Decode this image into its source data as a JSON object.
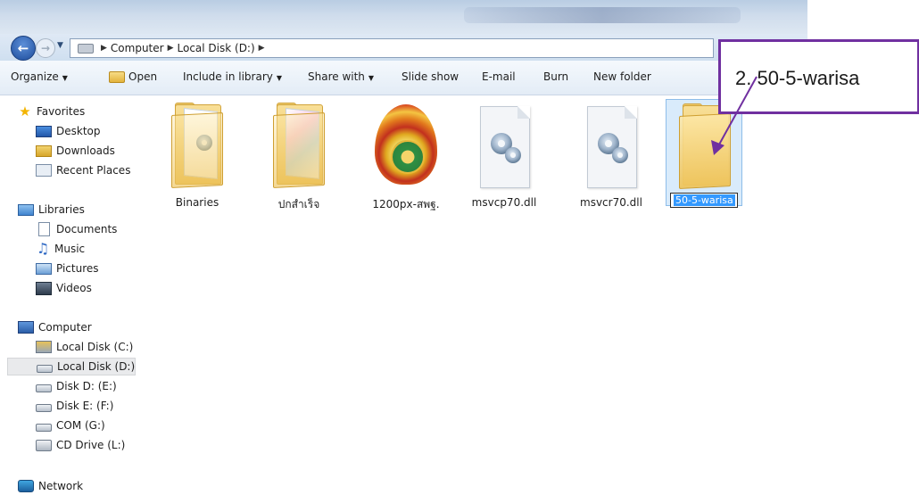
{
  "navigation": {
    "breadcrumb": [
      "Computer",
      "Local Disk (D:)"
    ]
  },
  "toolbar": {
    "organize": "Organize",
    "open": "Open",
    "include_in_library": "Include in library",
    "share_with": "Share with",
    "slide_show": "Slide show",
    "email": "E-mail",
    "burn": "Burn",
    "new_folder": "New folder"
  },
  "sidebar": {
    "favorites": {
      "label": "Favorites",
      "items": [
        "Desktop",
        "Downloads",
        "Recent Places"
      ]
    },
    "libraries": {
      "label": "Libraries",
      "items": [
        "Documents",
        "Music",
        "Pictures",
        "Videos"
      ]
    },
    "computer": {
      "label": "Computer",
      "items": [
        "Local Disk (C:)",
        "Local Disk (D:)",
        "Disk D: (E:)",
        "Disk E: (F:)",
        "COM (G:)",
        "CD Drive (L:)"
      ],
      "selected": "Local Disk (D:)"
    },
    "network": {
      "label": "Network"
    }
  },
  "files": [
    {
      "name": "Binaries",
      "type": "folder",
      "icon": "folder-icon"
    },
    {
      "name": "ปกสำเร็จ",
      "type": "folder",
      "icon": "folder-icon"
    },
    {
      "name": "1200px-สพฐ.",
      "type": "image",
      "icon": "emblem-thumbnail"
    },
    {
      "name": "msvcp70.dll",
      "type": "dll",
      "icon": "dll-file-icon"
    },
    {
      "name": "msvcr70.dll",
      "type": "dll",
      "icon": "dll-file-icon"
    },
    {
      "name": "50-5-warisa",
      "type": "folder",
      "icon": "folder-icon",
      "state": "renaming"
    }
  ],
  "callout": {
    "text": "2. 50-5-warisa",
    "border_color": "#7030a0"
  },
  "colors": {
    "selection_bg": "#d9ebfb",
    "rename_highlight": "#3399ff",
    "toolbar_bg": "#e3ecf6"
  }
}
